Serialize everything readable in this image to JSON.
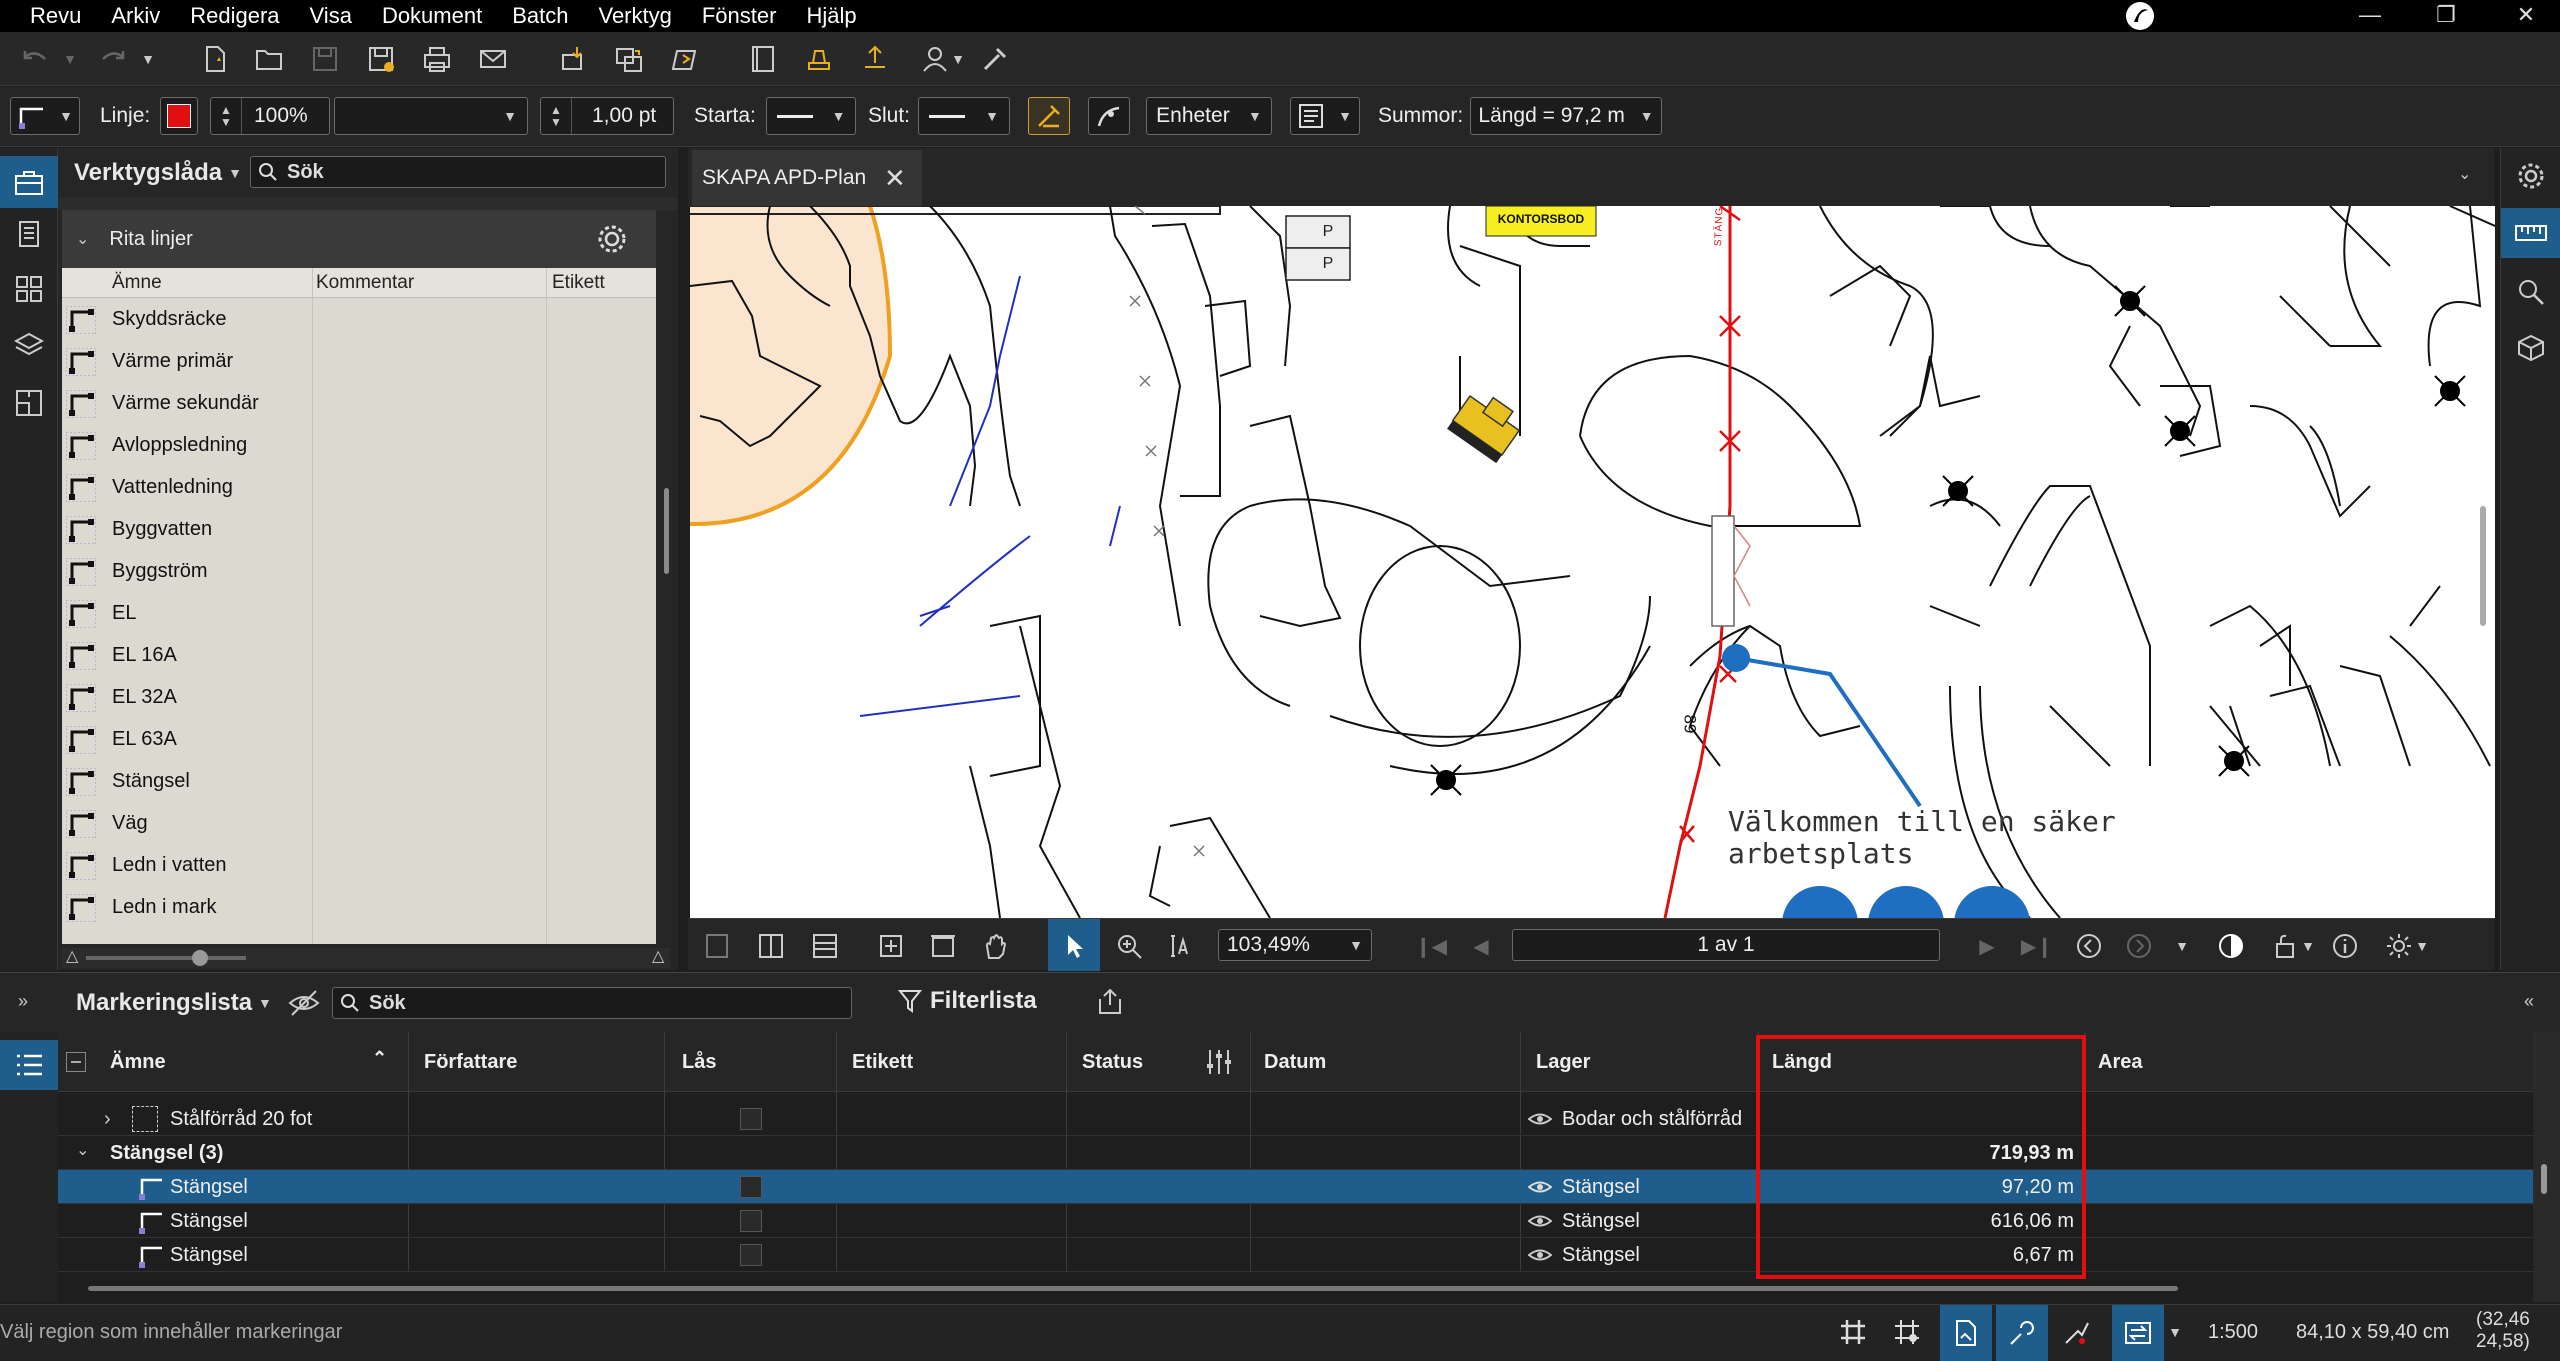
{
  "menu": [
    "Revu",
    "Arkiv",
    "Redigera",
    "Visa",
    "Dokument",
    "Batch",
    "Verktyg",
    "Fönster",
    "Hjälp"
  ],
  "toolbar2": {
    "line_label": "Linje:",
    "line_color": "#e01010",
    "opacity": "100%",
    "line_width": "1,00 pt",
    "start_label": "Starta:",
    "end_label": "Slut:",
    "units": "Enheter",
    "sum_label": "Summor:",
    "sum_value": "Längd = 97,2 m"
  },
  "toolpanel": {
    "title": "Verktygslåda",
    "search_placeholder": "Sök",
    "group": "Rita linjer",
    "columns": [
      "Ämne",
      "Kommentar",
      "Etikett"
    ],
    "items": [
      "Skyddsräcke",
      "Värme primär",
      "Värme sekundär",
      "Avloppsledning",
      "Vattenledning",
      "Byggvatten",
      "Byggström",
      "EL",
      "EL 16A",
      "EL 32A",
      "EL 63A",
      "Stängsel",
      "Väg",
      "Ledn i vatten",
      "Ledn i mark"
    ]
  },
  "document": {
    "tab": "SKAPA APD-Plan",
    "labels": {
      "kontorsbod": "KONTORSBOD",
      "welcome_1": "Välkommen till en säker",
      "welcome_2": "arbetsplats",
      "number": "89",
      "p1": "P",
      "p2": "P",
      "fence": "STÄNGSEL"
    }
  },
  "navbar": {
    "zoom": "103,49%",
    "page": "1 av 1"
  },
  "markup": {
    "title": "Markeringslista",
    "search_placeholder": "Sök",
    "filter": "Filterlista",
    "columns": [
      "Ämne",
      "Författare",
      "Lås",
      "Etikett",
      "Status",
      "Datum",
      "Lager",
      "Längd",
      "Area"
    ],
    "rows": [
      {
        "subject": "Stålförråd 20 fot",
        "layer": "Bodar och stålförråd",
        "length": ""
      },
      {
        "subject": "Stängsel (3)",
        "layer": "",
        "length": "719,93 m"
      },
      {
        "subject": "Stängsel",
        "layer": "Stängsel",
        "length": "97,20 m"
      },
      {
        "subject": "Stängsel",
        "layer": "Stängsel",
        "length": "616,06 m"
      },
      {
        "subject": "Stängsel",
        "layer": "Stängsel",
        "length": "6,67 m"
      }
    ]
  },
  "status": {
    "message": "Välj region som innehåller markeringar",
    "scale": "1:500",
    "size": "84,10 x 59,40 cm",
    "coords_1": "(32,46",
    "coords_2": "24,58)"
  }
}
